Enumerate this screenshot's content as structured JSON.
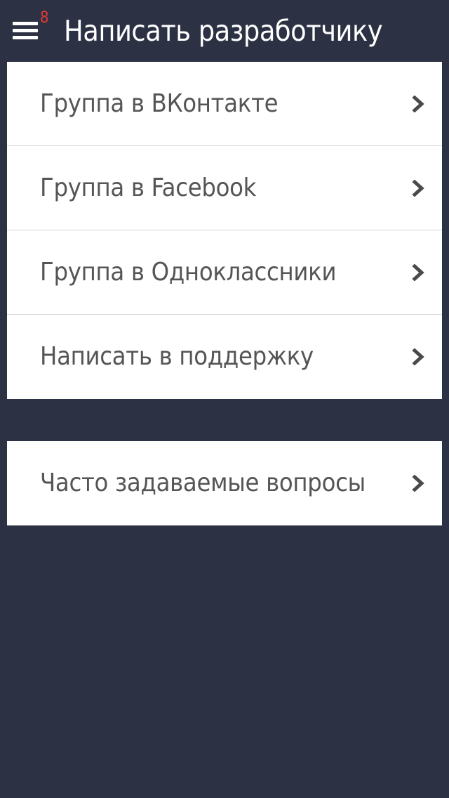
{
  "header": {
    "title": "Написать разработчику",
    "badge_count": "8",
    "menu_icon": "hamburger-menu-icon"
  },
  "links": [
    {
      "label": "Группа в ВКонтакте",
      "icon": "chevron-right-icon"
    },
    {
      "label": "Группа в Facebook",
      "icon": "chevron-right-icon"
    },
    {
      "label": "Группа в Одноклассники",
      "icon": "chevron-right-icon"
    },
    {
      "label": "Написать в поддержку",
      "icon": "chevron-right-icon"
    }
  ],
  "faq": [
    {
      "label": "Часто задаваемые вопросы",
      "icon": "chevron-right-icon"
    }
  ],
  "colors": {
    "background": "#2c3144",
    "row_background": "#ffffff",
    "row_text": "#555555",
    "chevron": "#4a4a4a",
    "badge": "#e53935",
    "divider": "#d4d4d4"
  }
}
